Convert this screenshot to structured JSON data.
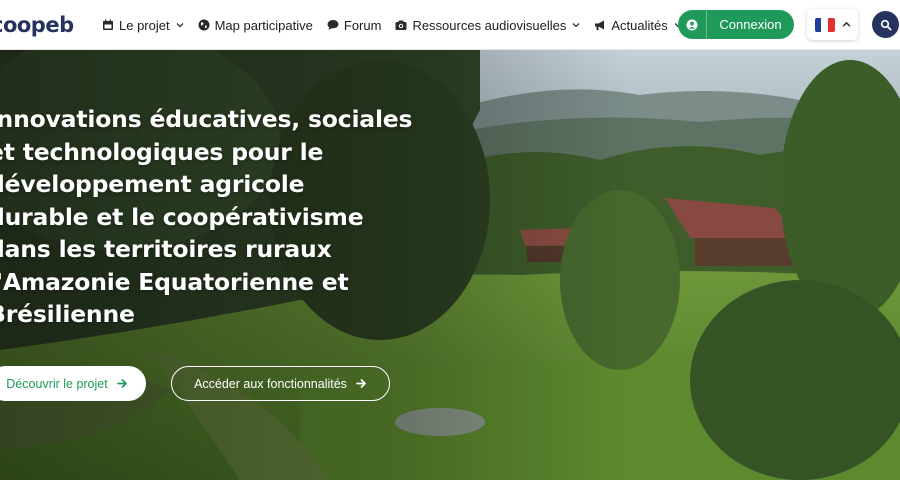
{
  "logo": {
    "text": "coopeb"
  },
  "nav": {
    "items": [
      {
        "label": "Le projet",
        "icon": "calendar-icon",
        "dropdown": true
      },
      {
        "label": "Map participative",
        "icon": "globe-icon",
        "dropdown": false
      },
      {
        "label": "Forum",
        "icon": "chat-icon",
        "dropdown": false
      },
      {
        "label": "Ressources audiovisuelles",
        "icon": "camera-icon",
        "dropdown": true
      },
      {
        "label": "Actualités",
        "icon": "megaphone-icon",
        "dropdown": true
      }
    ]
  },
  "header": {
    "login_label": "Connexion",
    "language": "fr"
  },
  "hero": {
    "title_lines": [
      "Innovations éducatives, sociales",
      "et technologiques pour le",
      "développement agricole",
      "durable et le coopérativisme",
      "dans les territoires ruraux",
      "l'Amazonie Equatorienne et",
      "Brésilienne"
    ],
    "discover_label": "Découvrir le projet",
    "features_label": "Accéder aux fonctionnalités"
  },
  "colors": {
    "brand_navy": "#26335f",
    "accent_green": "#1f9a5b",
    "flag": [
      "#1f3f9a",
      "#ffffff",
      "#e2312e"
    ]
  }
}
